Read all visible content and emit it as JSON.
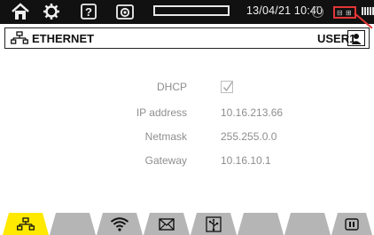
{
  "status_bar": {
    "datetime": "13/04/21 10:40",
    "icons": [
      "home-icon",
      "settings-icon",
      "help-icon",
      "camera-icon",
      "storage-gauge",
      "lock-icon",
      "network-status-icon",
      "battery-icon"
    ],
    "colors": {
      "background": "#111111",
      "highlight": "#e23636"
    }
  },
  "title_bar": {
    "title": "ETHERNET",
    "user": "USER1",
    "icons": [
      "network-icon",
      "user-icon"
    ]
  },
  "form": {
    "dhcp": {
      "label": "DHCP",
      "checked": true
    },
    "ip_address": {
      "label": "IP address",
      "value": "10.16.213.66"
    },
    "netmask": {
      "label": "Netmask",
      "value": "255.255.0.0"
    },
    "gateway": {
      "label": "Gateway",
      "value": "10.16.10.1"
    }
  },
  "tabs": [
    {
      "icon": "ethernet-icon",
      "active": true
    },
    {
      "icon": "",
      "active": false
    },
    {
      "icon": "wifi-icon",
      "active": false
    },
    {
      "icon": "mail-icon",
      "active": false
    },
    {
      "icon": "usb-icon",
      "active": false
    },
    {
      "icon": "",
      "active": false
    },
    {
      "icon": "",
      "active": false
    },
    {
      "icon": "pause-icon",
      "active": false
    }
  ],
  "colors": {
    "active_tab": "#ffe900",
    "inactive_tab": "#b5b5b5",
    "field_text": "#8e8e8e"
  }
}
